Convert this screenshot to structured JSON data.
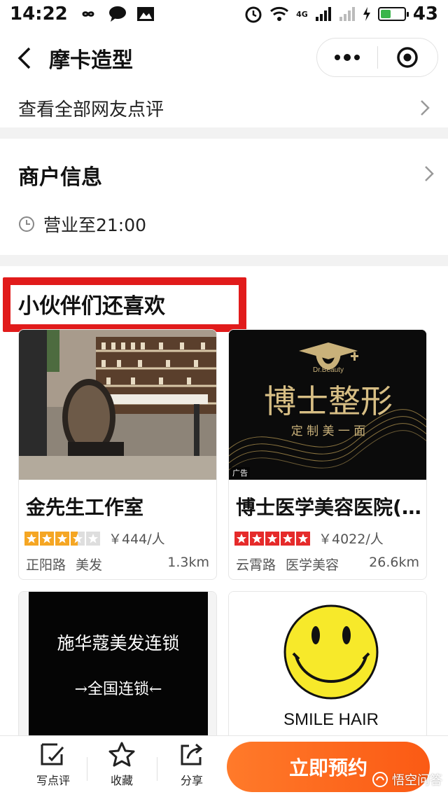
{
  "status_bar": {
    "time": "14:22",
    "network": "4G",
    "battery": "43",
    "battery_level": 0.43
  },
  "navbar": {
    "title": "摩卡造型"
  },
  "reviews": {
    "link_label": "查看全部网友点评"
  },
  "merchant": {
    "heading": "商户信息",
    "hours": "营业至21:00"
  },
  "recommend": {
    "title": "小伙伴们还喜欢",
    "cards": [
      {
        "name": "金先生工作室",
        "rating": 3.5,
        "star_color": "#f5a623",
        "price": "￥444/人",
        "area": "正阳路",
        "category": "美发",
        "distance": "1.3km",
        "image": "salon-interior-photo"
      },
      {
        "name": "博士医学美容医院(...",
        "rating": 5,
        "star_color": "#e52a2a",
        "price": "￥4022/人",
        "area": "云霄路",
        "category": "医学美容",
        "distance": "26.6km",
        "image": "dr-beauty-ad",
        "image_brand": "Dr.Beauty",
        "image_title": "博士整形",
        "image_subtitle": "定 制 美 一 面",
        "ad_tag": "广告"
      },
      {
        "image": "shihuakou-banner",
        "image_title": "施华蔻美发连锁",
        "image_subtitle": "→全国连锁←"
      },
      {
        "image": "smile-hair-logo",
        "image_title": "SMILE HAIR"
      }
    ]
  },
  "bottom_bar": {
    "write_review": "写点评",
    "favorite": "收藏",
    "share": "分享",
    "book_now": "立即预约"
  },
  "watermark": {
    "text": "悟空问答"
  },
  "colors": {
    "accent": "#fb5a14",
    "highlight_box": "#e11b1b"
  }
}
